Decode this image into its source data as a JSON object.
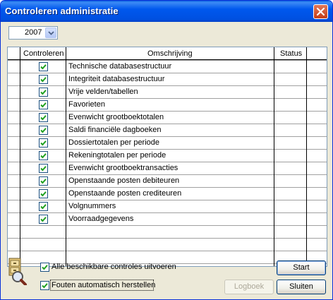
{
  "window": {
    "title": "Controleren administratie"
  },
  "year": {
    "value": "2007"
  },
  "columns": {
    "controleren": "Controleren",
    "omschrijving": "Omschrijving",
    "status": "Status"
  },
  "rows": [
    {
      "checked": true,
      "label": "Technische databasestructuur",
      "status": ""
    },
    {
      "checked": true,
      "label": "Integriteit databasestructuur",
      "status": ""
    },
    {
      "checked": true,
      "label": "Vrije velden/tabellen",
      "status": ""
    },
    {
      "checked": true,
      "label": "Favorieten",
      "status": ""
    },
    {
      "checked": true,
      "label": "Evenwicht grootboektotalen",
      "status": ""
    },
    {
      "checked": true,
      "label": "Saldi financiële dagboeken",
      "status": ""
    },
    {
      "checked": true,
      "label": "Dossiertotalen per periode",
      "status": ""
    },
    {
      "checked": true,
      "label": "Rekeningtotalen per periode",
      "status": ""
    },
    {
      "checked": true,
      "label": "Evenwicht grootboektransacties",
      "status": ""
    },
    {
      "checked": true,
      "label": "Openstaande posten debiteuren",
      "status": ""
    },
    {
      "checked": true,
      "label": "Openstaande posten crediteuren",
      "status": ""
    },
    {
      "checked": true,
      "label": "Volgnummers",
      "status": ""
    },
    {
      "checked": true,
      "label": "Voorraadgegevens",
      "status": ""
    }
  ],
  "options": {
    "all_checks": {
      "label": "Alle beschikbare controles uitvoeren",
      "checked": true
    },
    "auto_fix": {
      "label": "Fouten automatisch herstellen",
      "checked": true
    }
  },
  "buttons": {
    "start": "Start",
    "logboek": "Logboek",
    "sluiten": "Sluiten"
  },
  "colors": {
    "titlebar": "#0058ee",
    "check_green": "#21a121",
    "face": "#ece9d8",
    "border": "#7f9db9"
  },
  "icons": {
    "close": "close-icon",
    "dropdown": "chevron-down-icon",
    "check": "checkmark-icon",
    "app": "cabinet-magnifier-icon"
  }
}
